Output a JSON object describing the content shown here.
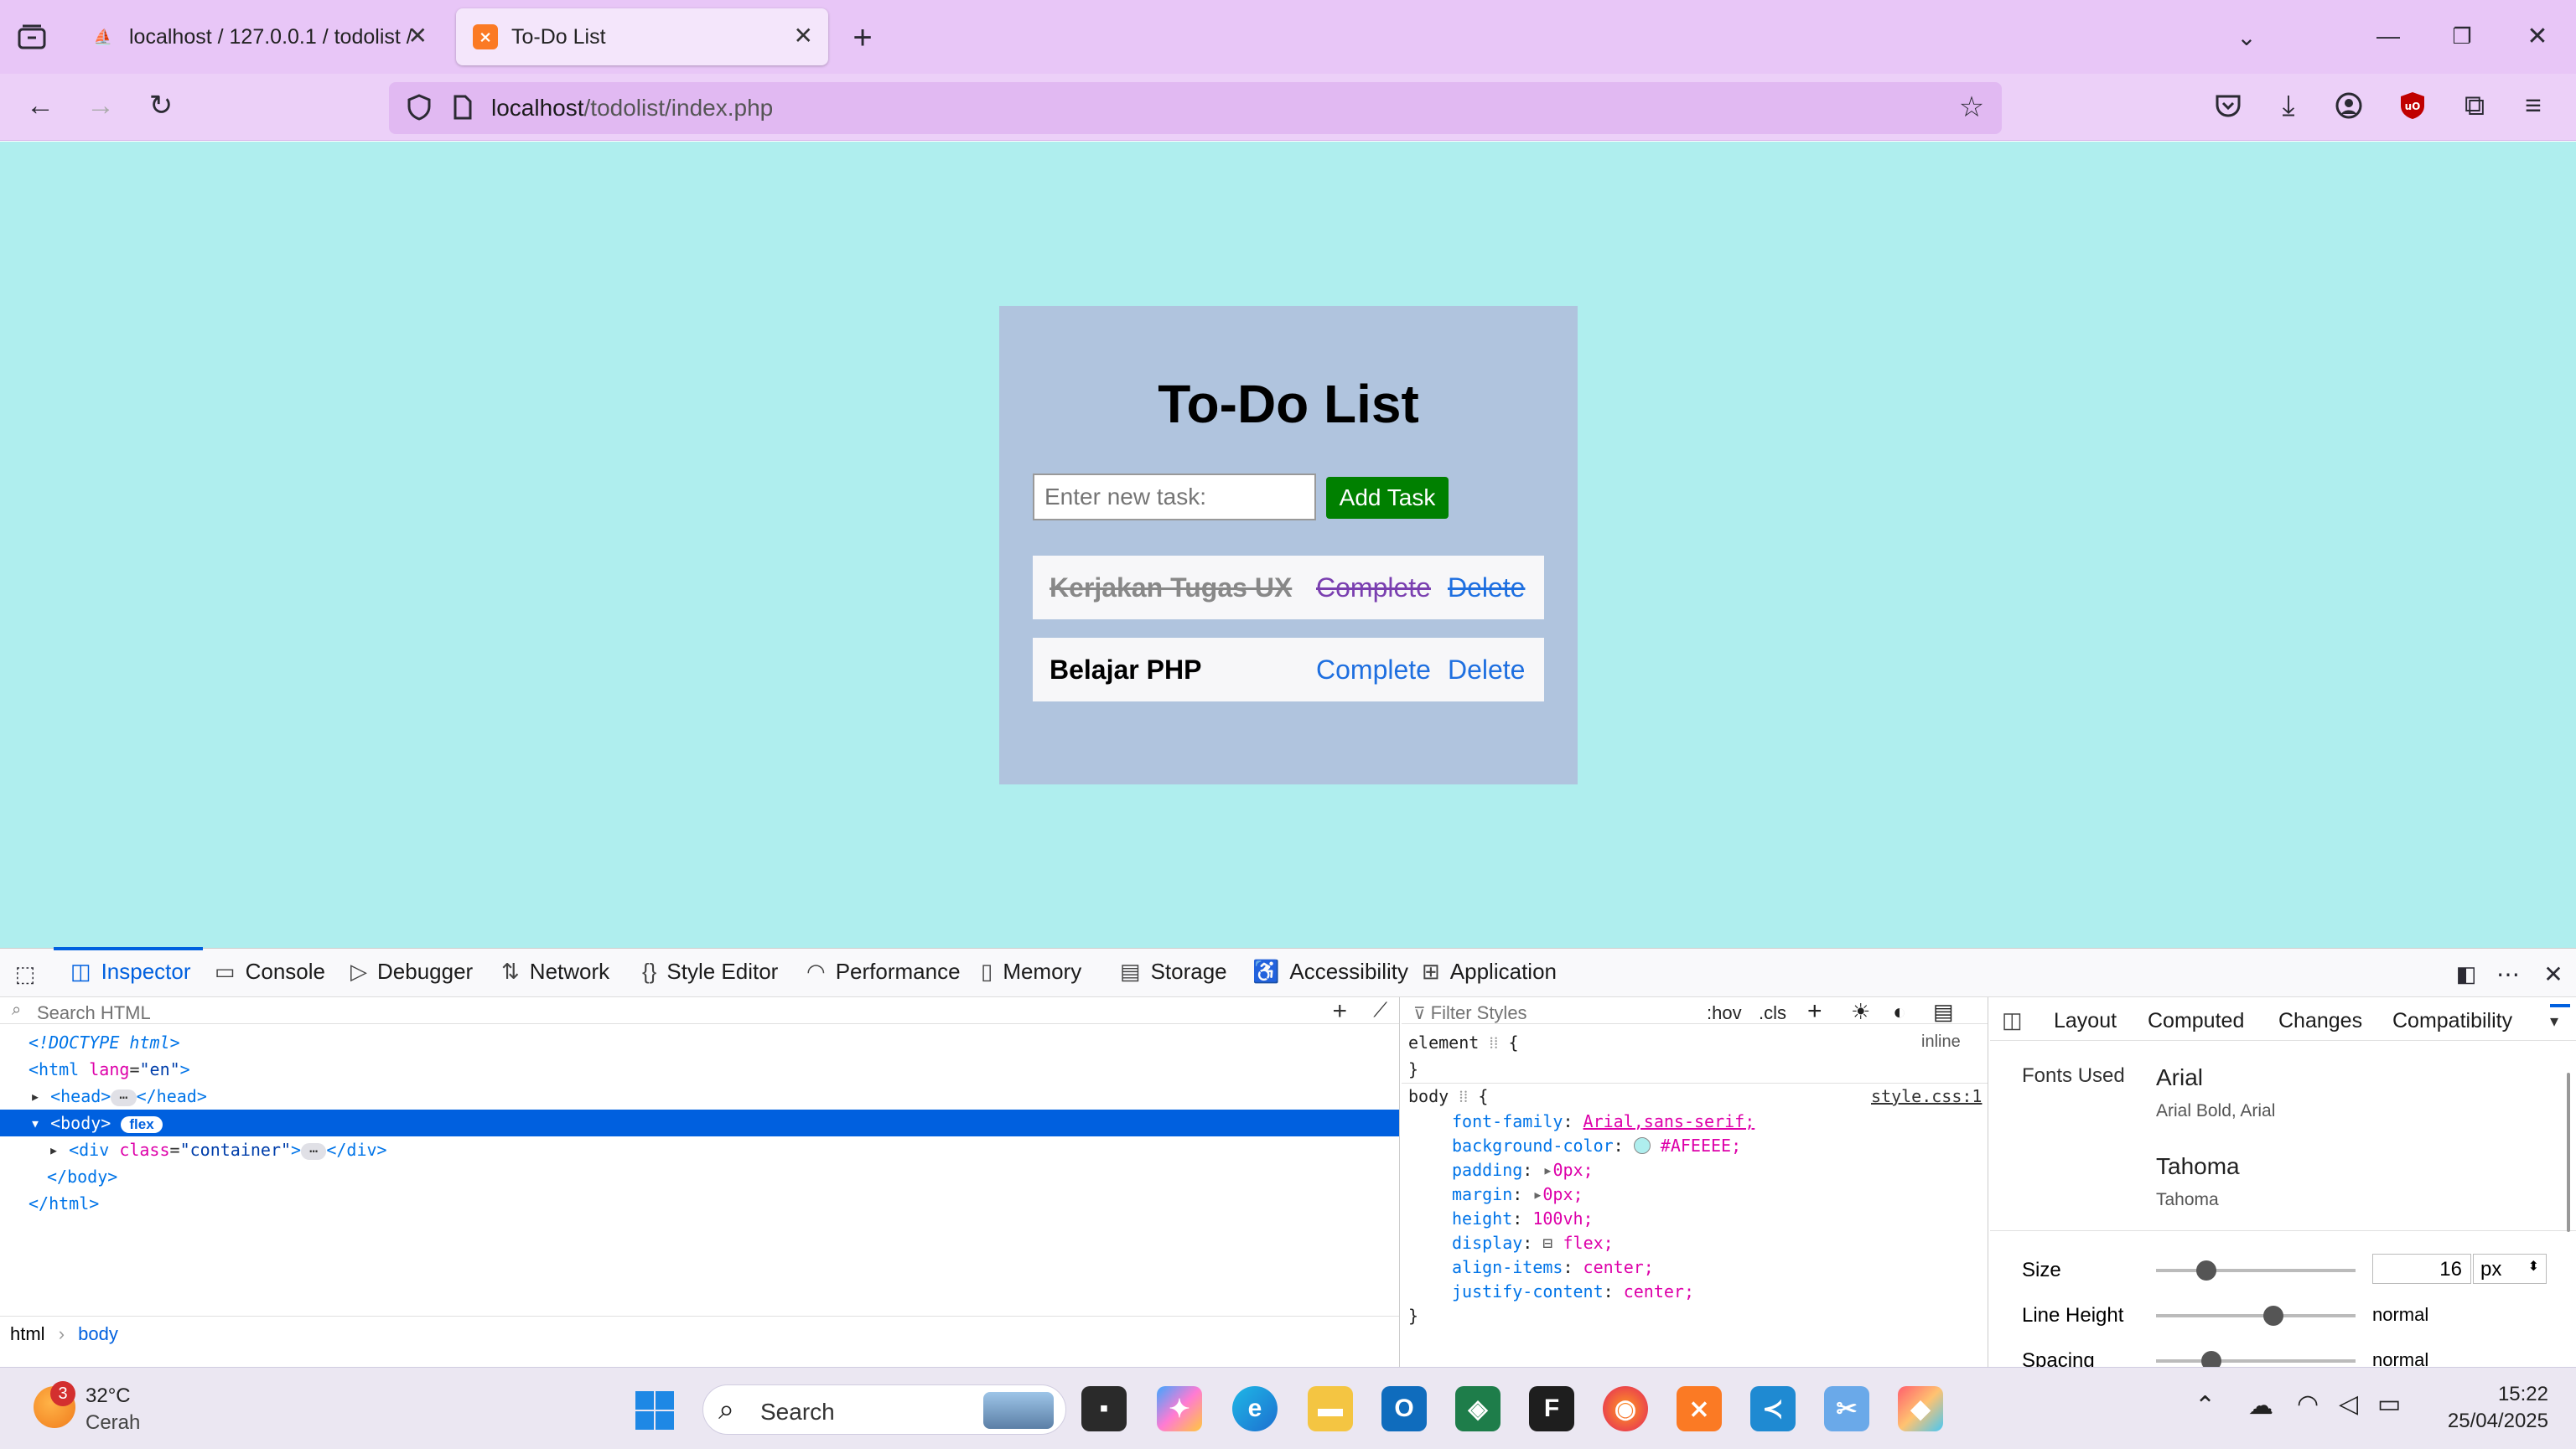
{
  "browser": {
    "tabs": [
      {
        "title": "localhost / 127.0.0.1 / todolist /",
        "active": false
      },
      {
        "title": "To-Do List",
        "active": true
      }
    ],
    "new_tab": "+",
    "url_host": "localhost",
    "url_path": "/todolist/index.php"
  },
  "page": {
    "heading": "To-Do List",
    "input_placeholder": "Enter new task:",
    "add_button": "Add Task",
    "tasks": [
      {
        "name": "Kerjakan Tugas UX",
        "completed": true,
        "complete_label": "Complete",
        "delete_label": "Delete"
      },
      {
        "name": "Belajar PHP",
        "completed": false,
        "complete_label": "Complete",
        "delete_label": "Delete"
      }
    ],
    "background_color": "#AFEEEE",
    "container_color": "#B0C4DE"
  },
  "devtools": {
    "tabs": [
      "Inspector",
      "Console",
      "Debugger",
      "Network",
      "Style Editor",
      "Performance",
      "Memory",
      "Storage",
      "Accessibility",
      "Application"
    ],
    "search_html_placeholder": "Search HTML",
    "html_tree": {
      "doctype": "<!DOCTYPE html>",
      "html_open_tag": "<html",
      "html_attr": "lang",
      "html_attr_val": "\"en\"",
      "head": "<head>",
      "head_close": "</head>",
      "body": "<body>",
      "body_badge": "flex",
      "div_open": "<div",
      "div_attr": "class",
      "div_attr_val": "\"container\"",
      "div_close": "</div>",
      "body_close": "</body>",
      "html_close": "</html>"
    },
    "breadcrumb": [
      "html",
      "body"
    ],
    "filter_styles_placeholder": "Filter Styles",
    "hov": ":hov",
    "cls": ".cls",
    "element_rule": "element",
    "element_source": "inline",
    "body_rule": "body",
    "body_source": "style.css:1",
    "declarations": [
      {
        "prop": "font-family",
        "value": "Arial,sans-serif;"
      },
      {
        "prop": "background-color",
        "value": "#AFEEEE;"
      },
      {
        "prop": "padding",
        "value": "0px;"
      },
      {
        "prop": "margin",
        "value": "0px;"
      },
      {
        "prop": "height",
        "value": "100vh;"
      },
      {
        "prop": "display",
        "value": "flex;"
      },
      {
        "prop": "align-items",
        "value": "center;"
      },
      {
        "prop": "justify-content",
        "value": "center;"
      }
    ],
    "layout_tabs": [
      "Layout",
      "Computed",
      "Changes",
      "Compatibility"
    ],
    "fonts_used_label": "Fonts Used",
    "fonts": [
      {
        "name": "Arial",
        "sub": "Arial Bold, Arial"
      },
      {
        "name": "Tahoma",
        "sub": "Tahoma"
      }
    ],
    "size_label": "Size",
    "size_value": "16",
    "size_unit": "px",
    "line_height_label": "Line Height",
    "line_height_value": "normal",
    "spacing_label": "Spacing",
    "spacing_value": "normal"
  },
  "taskbar": {
    "weather_temp": "32°C",
    "weather_desc": "Cerah",
    "weather_badge": "3",
    "search_label": "Search",
    "time": "15:22",
    "date": "25/04/2025"
  }
}
